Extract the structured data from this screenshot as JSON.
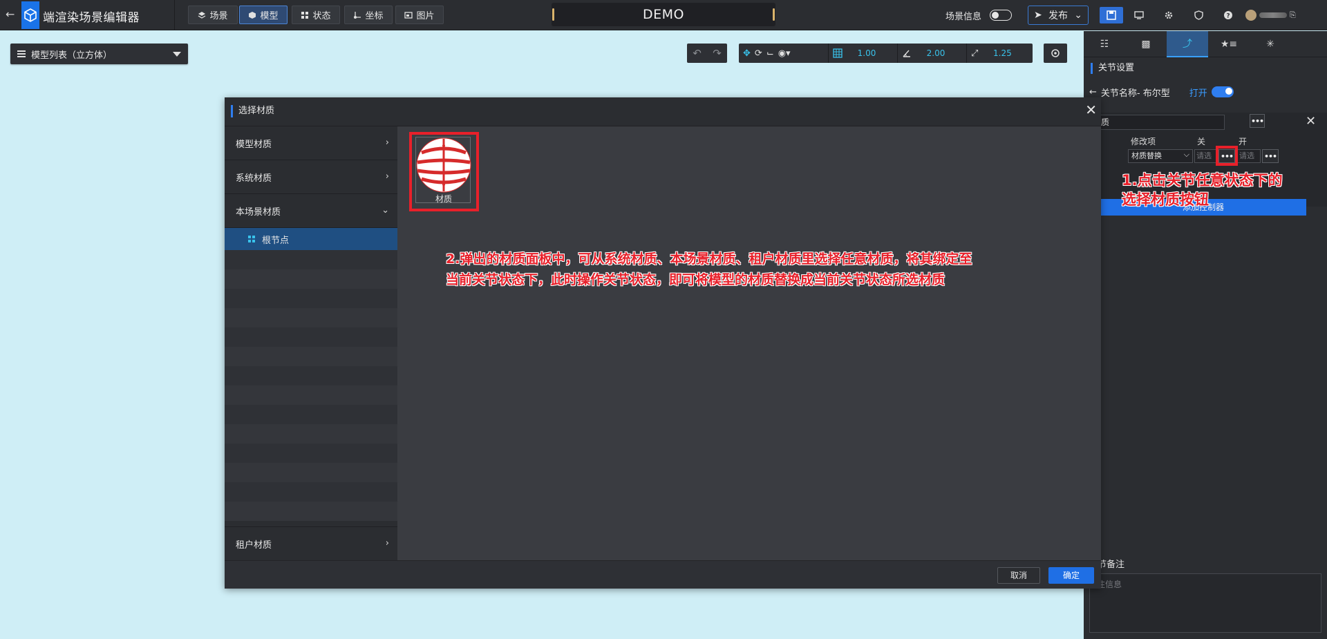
{
  "app": {
    "title": "端渲染场景编辑器"
  },
  "topbar": {
    "tabs": [
      {
        "label": "场景",
        "icon": "layers-icon"
      },
      {
        "label": "模型",
        "icon": "cube-icon",
        "active": true
      },
      {
        "label": "状态",
        "icon": "grid-icon"
      },
      {
        "label": "坐标",
        "icon": "axis-icon"
      },
      {
        "label": "图片",
        "icon": "image-icon"
      }
    ],
    "demo": "DEMO",
    "scene_info": "场景信息",
    "publish": "发布",
    "accent": "#1a73e8"
  },
  "viewport": {
    "model_list": "模型列表（立方体）",
    "transform": {
      "grid": "1.00",
      "angle": "2.00",
      "scale": "1.25"
    }
  },
  "right_panel": {
    "section_title": "关节设置",
    "joint_name": "关节名称- 布尔型",
    "open_label": "打开",
    "state_input": "质",
    "columns": {
      "modify": "修改项",
      "close": "关",
      "open": "开"
    },
    "modify_select": "材质替换",
    "pick_close": "请选",
    "pick_open": "请选择",
    "bluebar": "添加控制器",
    "notes_label": "节备注",
    "notes_placeholder": "注信息"
  },
  "modal": {
    "title": "选择材质",
    "sidebar": [
      {
        "label": "模型材质"
      },
      {
        "label": "系统材质"
      },
      {
        "label": "本场景材质"
      }
    ],
    "sub_item": "根节点",
    "tenant": "租户材质",
    "material_name": "材质",
    "cancel": "取消",
    "ok": "确定"
  },
  "annotations": {
    "step1_line1": "1.点击关节任意状态下的",
    "step1_line2": "选择材质按钮",
    "step2_line1": "2.弹出的材质面板中，可从系统材质、本场景材质、租户材质里选择任意材质，将其绑定至",
    "step2_line2": "当前关节状态下，此时操作关节状态，即可将模型的材质替换成当前关节状态所选材质",
    "color": "#e8202a"
  }
}
